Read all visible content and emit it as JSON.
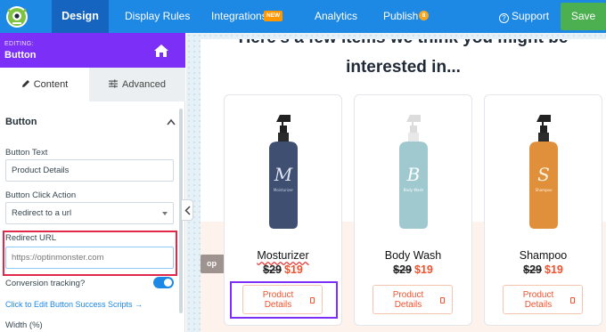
{
  "topbar": {
    "tabs": [
      {
        "label": "Design",
        "active": true
      },
      {
        "label": "Display Rules"
      },
      {
        "label": "Integrations",
        "badge": "NEW"
      },
      {
        "label": "Analytics"
      },
      {
        "label": "Publish",
        "badge_count": "8"
      }
    ],
    "support_label": "Support",
    "save_label": "Save",
    "colors": {
      "bar": "#1e88e5",
      "active_tab": "#1565c0",
      "save": "#4caf50"
    }
  },
  "sidebar": {
    "editing_label": "EDITING:",
    "editing_title": "Button",
    "home_icon": "home-icon",
    "tabs": [
      {
        "label": "Content",
        "icon": "pencil-icon",
        "active": true
      },
      {
        "label": "Advanced",
        "icon": "sliders-icon"
      }
    ],
    "section_title": "Button",
    "fields": {
      "button_text": {
        "label": "Button Text",
        "value": "Product Details"
      },
      "click_action": {
        "label": "Button Click Action",
        "value": "Redirect to a url"
      },
      "redirect_url": {
        "label": "Redirect URL",
        "placeholder": "https://optinmonster.com",
        "value": ""
      },
      "conversion": {
        "label": "Conversion tracking?",
        "enabled": true
      }
    },
    "success_link": "Click to Edit Button Success Scripts →",
    "width_label": "Width (%)",
    "accent_color": "#7b2ff7"
  },
  "canvas": {
    "heading_line1": "Here's a few items we think you might be",
    "heading_line2": "interested in...",
    "side_tab_label": "op",
    "products": [
      {
        "name": "Mosturizer",
        "old_price": "$29",
        "new_price": "$19",
        "button": "Product Details",
        "bottle_color": "#3f4f72",
        "bottle_letter": "M",
        "bottle_label": "Moisturizer"
      },
      {
        "name": "Body Wash",
        "old_price": "$29",
        "new_price": "$19",
        "button": "Product Details",
        "bottle_color": "#9fc9cf",
        "bottle_letter": "B",
        "bottle_label": "Body Wash"
      },
      {
        "name": "Shampoo",
        "old_price": "$29",
        "new_price": "$19",
        "button": "Product Details",
        "bottle_color": "#e0903a",
        "bottle_letter": "S",
        "bottle_label": "Shampoo"
      }
    ]
  }
}
